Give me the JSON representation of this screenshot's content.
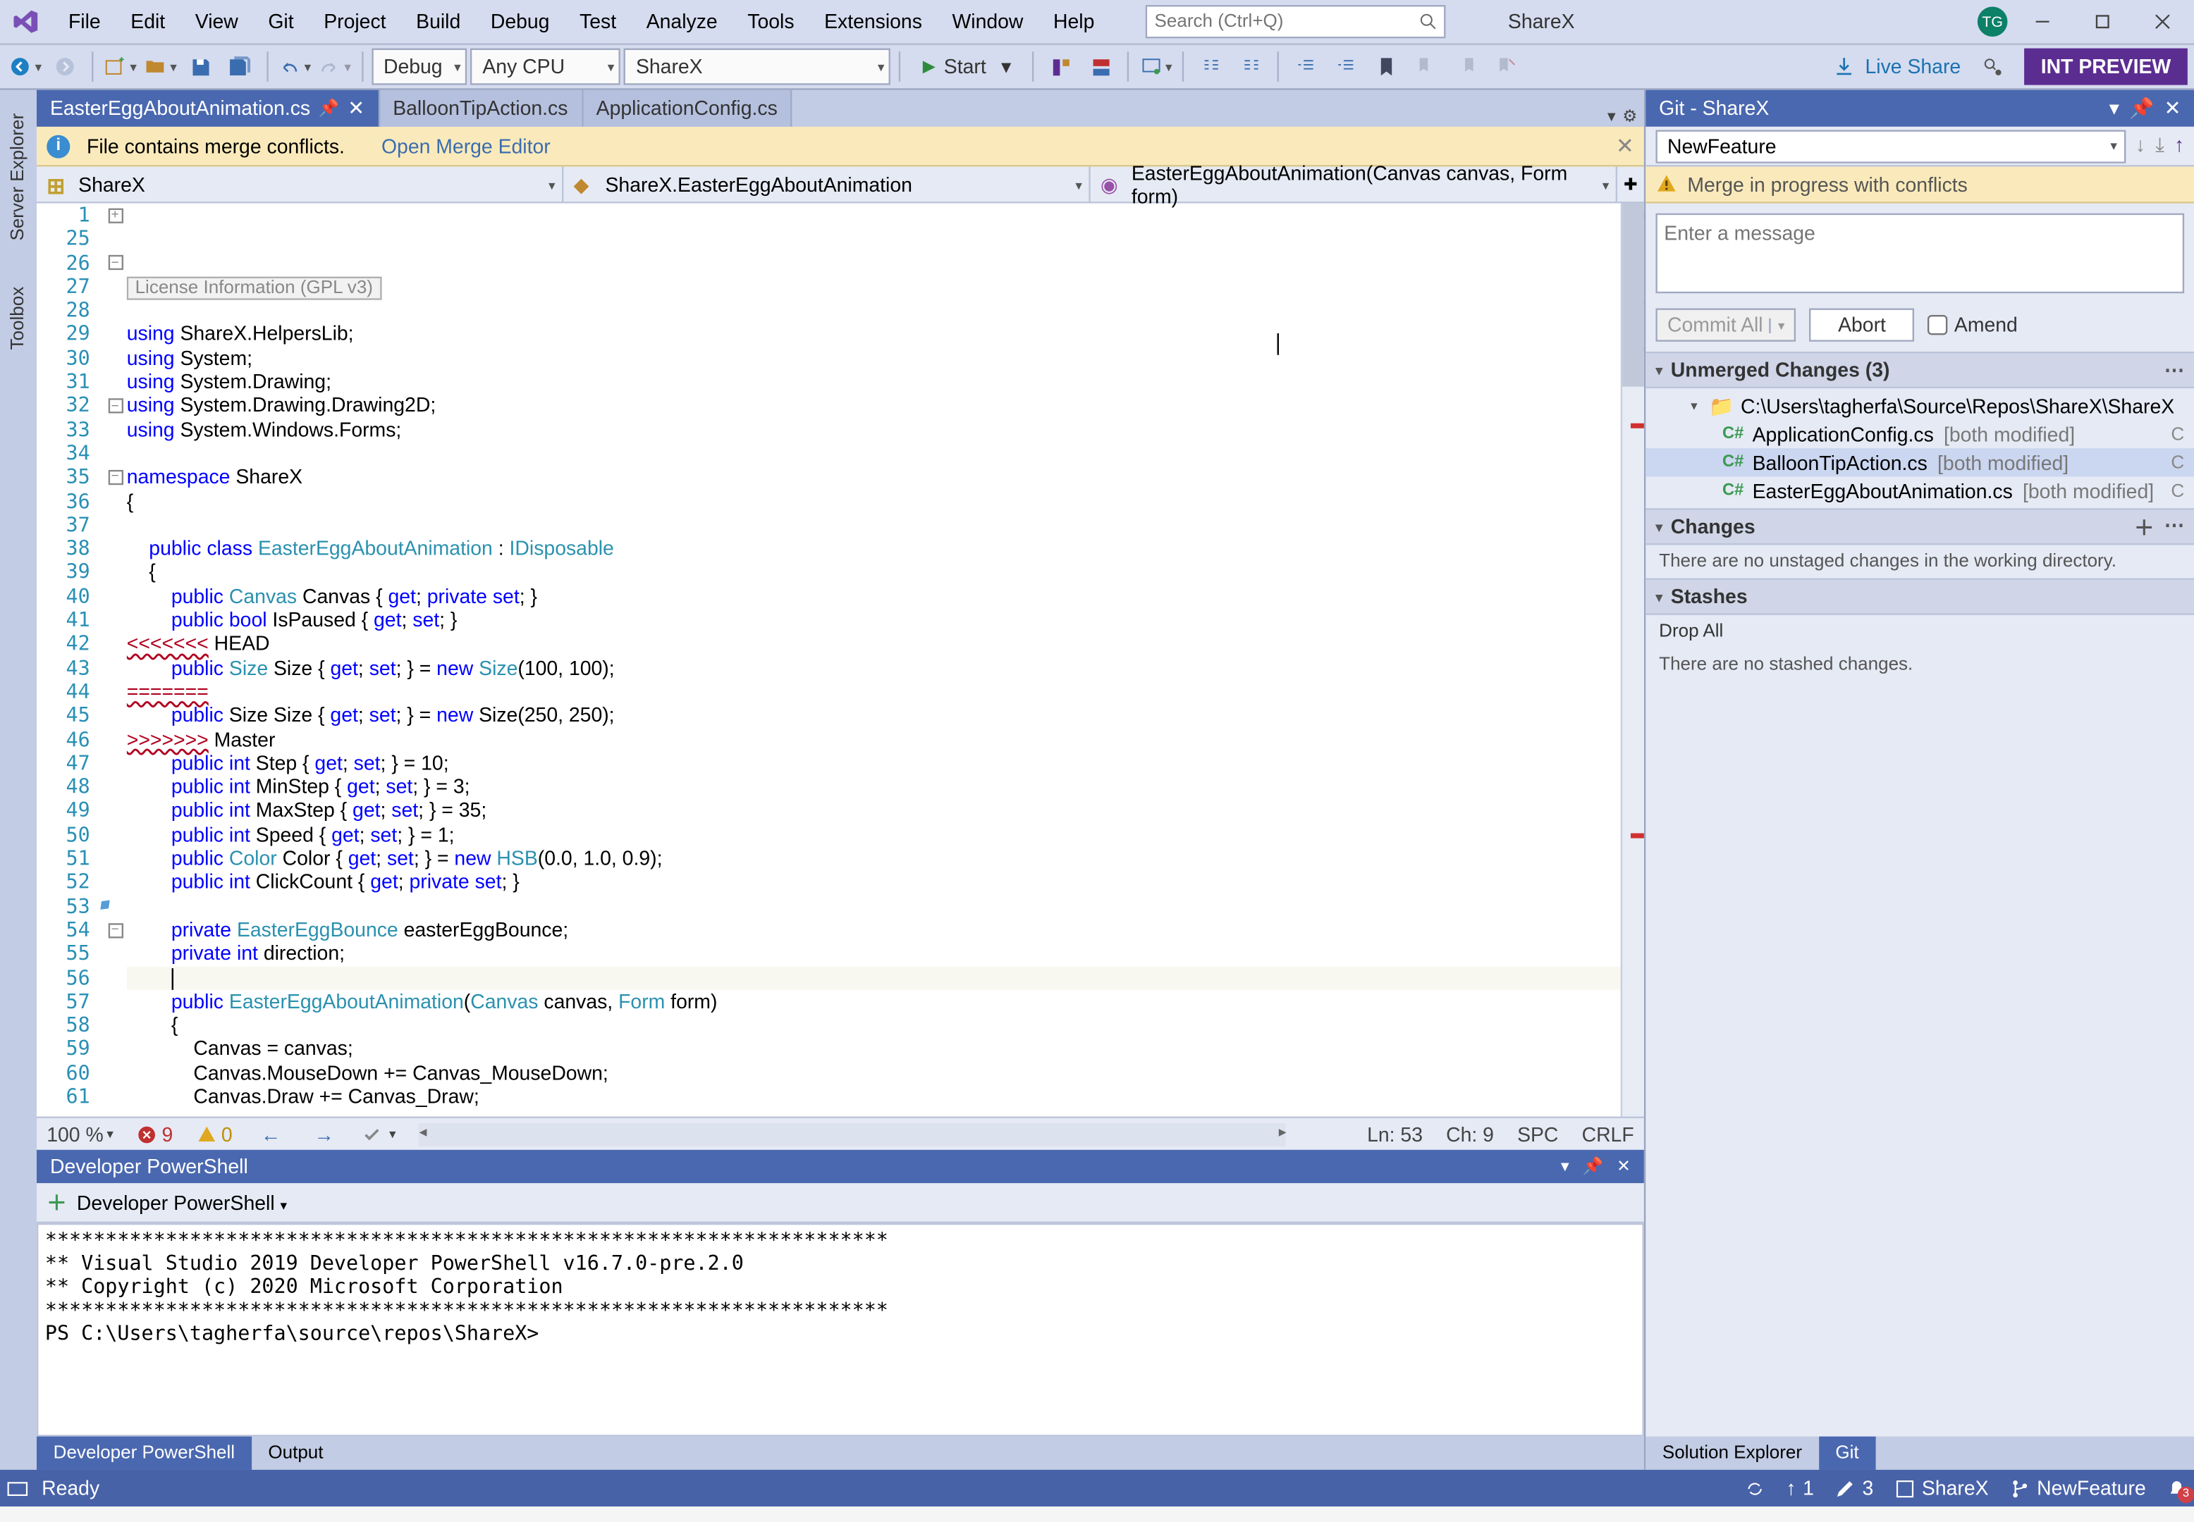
{
  "titlebar": {
    "menus": [
      "File",
      "Edit",
      "View",
      "Git",
      "Project",
      "Build",
      "Debug",
      "Test",
      "Analyze",
      "Tools",
      "Extensions",
      "Window",
      "Help"
    ],
    "search_placeholder": "Search (Ctrl+Q)",
    "solution": "ShareX",
    "avatar": "TG"
  },
  "toolbar": {
    "config": "Debug",
    "platform": "Any CPU",
    "startup": "ShareX",
    "start": "Start",
    "live_share": "Live Share",
    "int_preview": "INT PREVIEW"
  },
  "left_rails": [
    "Server Explorer",
    "Toolbox"
  ],
  "doc_tabs": [
    {
      "label": "EasterEggAboutAnimation.cs",
      "active": true
    },
    {
      "label": "BalloonTipAction.cs",
      "active": false
    },
    {
      "label": "ApplicationConfig.cs",
      "active": false
    }
  ],
  "info_bar": {
    "msg": "File contains merge conflicts.",
    "link": "Open Merge Editor"
  },
  "nav_bar": {
    "project": "ShareX",
    "type": "ShareX.EasterEggAboutAnimation",
    "member": "EasterEggAboutAnimation(Canvas canvas, Form form)"
  },
  "code": {
    "first_line": 1,
    "lines": [
      {
        "n": 1,
        "fold": "plus",
        "html": "<span class='collapsed-region'>License Information (GPL v3)</span>"
      },
      {
        "n": 25,
        "html": ""
      },
      {
        "n": 26,
        "fold": "minus",
        "html": "<span class='kw'>using</span> ShareX.HelpersLib;"
      },
      {
        "n": 27,
        "html": "<span class='kw'>using</span> System;"
      },
      {
        "n": 28,
        "html": "<span class='kw'>using</span> System.Drawing;"
      },
      {
        "n": 29,
        "html": "<span class='kw'>using</span> System.Drawing.Drawing2D;"
      },
      {
        "n": 30,
        "html": "<span class='kw'>using</span> System.Windows.Forms;"
      },
      {
        "n": 31,
        "html": ""
      },
      {
        "n": 32,
        "fold": "minus",
        "html": "<span class='kw'>namespace</span> ShareX"
      },
      {
        "n": 33,
        "html": "{"
      },
      {
        "n": 34,
        "html": ""
      },
      {
        "n": 35,
        "fold": "minus",
        "html": "    <span class='kw'>public</span> <span class='kw'>class</span> <span class='type'>EasterEggAboutAnimation</span> : <span class='type'>IDisposable</span>"
      },
      {
        "n": 36,
        "html": "    {"
      },
      {
        "n": 37,
        "html": "        <span class='kw'>public</span> <span class='type'>Canvas</span> Canvas { <span class='kw'>get</span>; <span class='kw'>private</span> <span class='kw'>set</span>; }"
      },
      {
        "n": 38,
        "html": "        <span class='kw'>public</span> <span class='kw'>bool</span> IsPaused { <span class='kw'>get</span>; <span class='kw'>set</span>; }"
      },
      {
        "n": 39,
        "html": "<span class='str-conflict'>&lt;&lt;&lt;&lt;&lt;&lt;&lt;</span> HEAD"
      },
      {
        "n": 40,
        "html": "        <span class='kw'>public</span> <span class='type'>Size</span> Size { <span class='kw'>get</span>; <span class='kw'>set</span>; } = <span class='kw'>new</span> <span class='type'>Size</span>(100, 100);"
      },
      {
        "n": 41,
        "html": "<span class='str-conflict'>=======</span>"
      },
      {
        "n": 42,
        "html": "        <span class='kw'>public</span> Size Size { <span class='kw'>get</span>; <span class='kw'>set</span>; } = <span class='kw'>new</span> Size(250, 250);"
      },
      {
        "n": 43,
        "html": "<span class='str-conflict'>&gt;&gt;&gt;&gt;&gt;&gt;&gt;</span> Master"
      },
      {
        "n": 44,
        "html": "        <span class='kw'>public</span> <span class='kw'>int</span> Step { <span class='kw'>get</span>; <span class='kw'>set</span>; } = 10;"
      },
      {
        "n": 45,
        "html": "        <span class='kw'>public</span> <span class='kw'>int</span> MinStep { <span class='kw'>get</span>; <span class='kw'>set</span>; } = 3;"
      },
      {
        "n": 46,
        "html": "        <span class='kw'>public</span> <span class='kw'>int</span> MaxStep { <span class='kw'>get</span>; <span class='kw'>set</span>; } = 35;"
      },
      {
        "n": 47,
        "html": "        <span class='kw'>public</span> <span class='kw'>int</span> Speed { <span class='kw'>get</span>; <span class='kw'>set</span>; } = 1;"
      },
      {
        "n": 48,
        "html": "        <span class='kw'>public</span> <span class='type'>Color</span> Color { <span class='kw'>get</span>; <span class='kw'>set</span>; } = <span class='kw'>new</span> <span class='type'>HSB</span>(0.0, 1.0, 0.9);"
      },
      {
        "n": 49,
        "html": "        <span class='kw'>public</span> <span class='kw'>int</span> ClickCount { <span class='kw'>get</span>; <span class='kw'>private</span> <span class='kw'>set</span>; }"
      },
      {
        "n": 50,
        "html": ""
      },
      {
        "n": 51,
        "html": "        <span class='kw'>private</span> <span class='type'>EasterEggBounce</span> easterEggBounce;"
      },
      {
        "n": 52,
        "html": "        <span class='kw'>private</span> <span class='kw'>int</span> direction;"
      },
      {
        "n": 53,
        "mod": true,
        "caret": true,
        "html": "        <span class='cursor-caret'></span>"
      },
      {
        "n": 54,
        "fold": "minus",
        "html": "        <span class='kw'>public</span> <span class='type'>EasterEggAboutAnimation</span>(<span class='type'>Canvas</span> canvas, <span class='type'>Form</span> form)"
      },
      {
        "n": 55,
        "html": "        {"
      },
      {
        "n": 56,
        "html": "            Canvas = canvas;"
      },
      {
        "n": 57,
        "html": "            Canvas.MouseDown += Canvas_MouseDown;"
      },
      {
        "n": 58,
        "html": "            Canvas.Draw += Canvas_Draw;"
      },
      {
        "n": 59,
        "html": ""
      },
      {
        "n": 60,
        "html": "            easterEggBounce = <span class='kw'>new</span> <span class='type'>EasterEggBounce</span>(form);"
      },
      {
        "n": 61,
        "html": "        }"
      }
    ]
  },
  "editor_status": {
    "zoom": "100 %",
    "errors": "9",
    "warnings": "0",
    "ln": "Ln: 53",
    "ch": "Ch: 9",
    "ins": "SPC",
    "crlf": "CRLF"
  },
  "powershell": {
    "title": "Developer PowerShell",
    "toolbar_label": "Developer PowerShell",
    "content": "**********************************************************************\n** Visual Studio 2019 Developer PowerShell v16.7.0-pre.2.0\n** Copyright (c) 2020 Microsoft Corporation\n**********************************************************************\nPS C:\\Users\\tagherfa\\source\\repos\\ShareX>"
  },
  "bottom_tabs": [
    "Developer PowerShell",
    "Output"
  ],
  "git": {
    "title": "Git - ShareX",
    "branch": "NewFeature",
    "warn": "Merge in progress with conflicts",
    "msg_placeholder": "Enter a message",
    "commit_label": "Commit All",
    "abort": "Abort",
    "amend": "Amend",
    "unmerged": {
      "header": "Unmerged Changes (3)",
      "repo": "C:\\Users\\tagherfa\\Source\\Repos\\ShareX\\ShareX",
      "files": [
        {
          "name": "ApplicationConfig.cs",
          "status": "[both modified]",
          "recycle": "C"
        },
        {
          "name": "BalloonTipAction.cs",
          "status": "[both modified]",
          "recycle": "C",
          "sel": true
        },
        {
          "name": "EasterEggAboutAnimation.cs",
          "status": "[both modified]",
          "recycle": "C"
        }
      ]
    },
    "changes": {
      "header": "Changes",
      "msg": "There are no unstaged changes in the working directory."
    },
    "stashes": {
      "header": "Stashes",
      "drop": "Drop All",
      "msg": "There are no stashed changes."
    }
  },
  "right_tabs": [
    "Solution Explorer",
    "Git"
  ],
  "statusbar": {
    "ready": "Ready",
    "repo_up": "1",
    "repo_down": "3",
    "repo": "ShareX",
    "branch": "NewFeature",
    "notif": "3"
  }
}
